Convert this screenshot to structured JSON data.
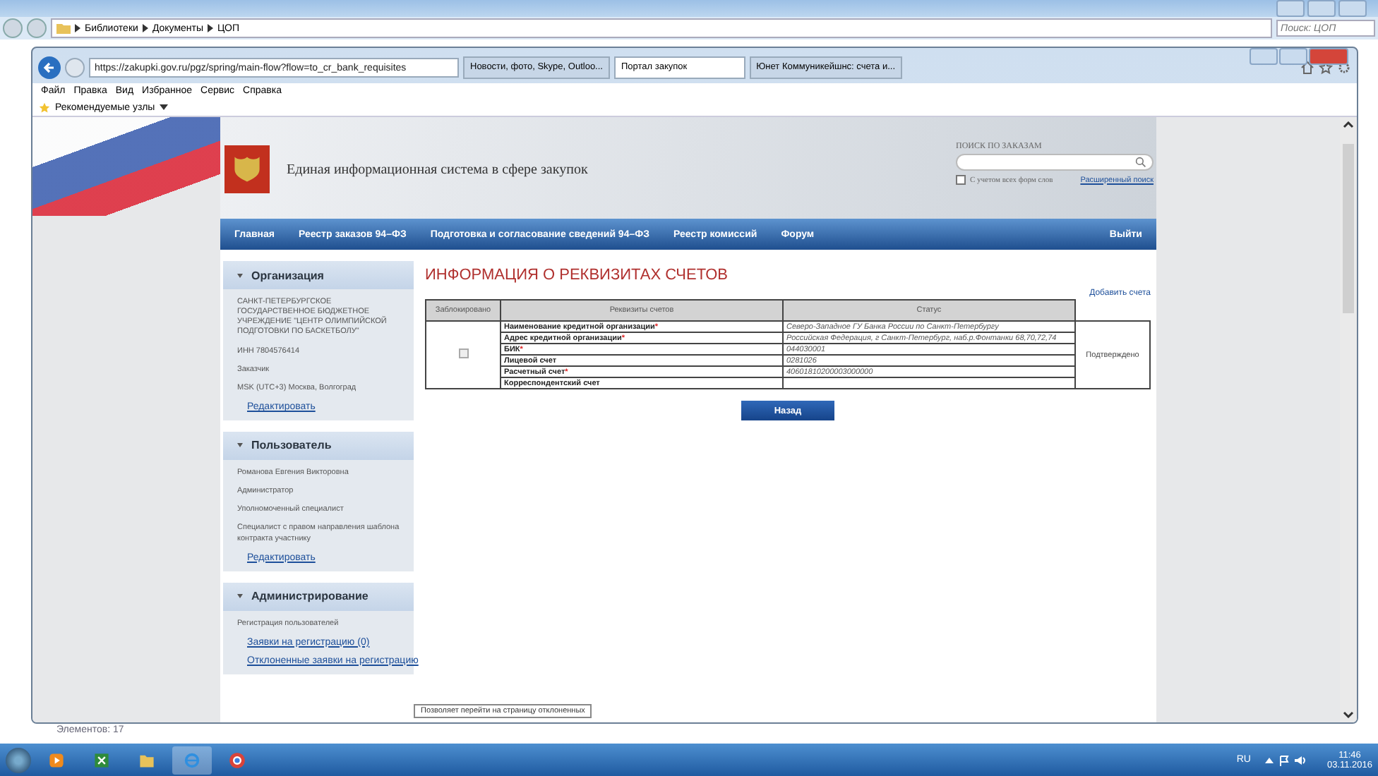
{
  "explorer": {
    "breadcrumbs": [
      "Библиотеки",
      "Документы",
      "ЦОП"
    ],
    "search_placeholder": "Поиск: ЦОП",
    "status": "Элементов: 17"
  },
  "browser": {
    "address": "https://zakupki.gov.ru/pgz/spring/main-flow?flow=to_cr_bank_requisites",
    "tabs": [
      {
        "label": "Новости, фото, Skype, Outloo...",
        "selected": false
      },
      {
        "label": "Портал закупок",
        "selected": true
      },
      {
        "label": "Юнет Коммуникейшнс: счета и...",
        "selected": false
      }
    ],
    "menu": [
      "Файл",
      "Правка",
      "Вид",
      "Избранное",
      "Сервис",
      "Справка"
    ],
    "favorites": "Рекомендуемые узлы"
  },
  "site": {
    "title": "Единая информационная система в сфере закупок",
    "search": {
      "label": "ПОИСК ПО ЗАКАЗАМ",
      "checkbox_label": "С учетом всех форм слов",
      "checked": false,
      "advanced_link": "Расширенный поиск"
    },
    "nav": [
      "Главная",
      "Реестр заказов 94–ФЗ",
      "Подготовка и согласование сведений 94–ФЗ",
      "Реестр комиссий",
      "Форум"
    ],
    "logout": "Выйти"
  },
  "sidebar": [
    {
      "title": "Организация",
      "items": [
        {
          "kind": "text",
          "text": "САНКТ-ПЕТЕРБУРГСКОЕ ГОСУДАРСТВЕННОЕ БЮДЖЕТНОЕ УЧРЕЖДЕНИЕ \"ЦЕНТР ОЛИМПИЙСКОЙ ПОДГОТОВКИ ПО БАСКЕТБОЛУ\""
        },
        {
          "kind": "text",
          "text": "ИНН 7804576414"
        },
        {
          "kind": "text",
          "text": "Заказчик"
        },
        {
          "kind": "text",
          "text": "MSK (UTC+3) Москва, Волгоград"
        },
        {
          "kind": "link",
          "text": "Редактировать"
        }
      ]
    },
    {
      "title": "Пользователь",
      "items": [
        {
          "kind": "text",
          "text": "Романова Евгения Викторовна"
        },
        {
          "kind": "text",
          "text": "Администратор"
        },
        {
          "kind": "text",
          "text": "Уполномоченный специалист"
        },
        {
          "kind": "text",
          "text": "Специалист с правом направления шаблона контракта участнику"
        },
        {
          "kind": "link",
          "text": "Редактировать"
        }
      ]
    },
    {
      "title": "Администрирование",
      "items": [
        {
          "kind": "text",
          "text": "Регистрация пользователей"
        },
        {
          "kind": "link",
          "text": "Заявки на регистрацию (0)"
        },
        {
          "kind": "link",
          "text": "Отклоненные заявки на регистрацию"
        }
      ]
    }
  ],
  "main": {
    "heading": "ИНФОРМАЦИЯ О РЕКВИЗИТАХ СЧЕТОВ",
    "add_link": "Добавить счета",
    "table": {
      "columns": [
        "Заблокировано",
        "Реквизиты счетов",
        "Статус"
      ],
      "blocked": false,
      "status": "Подтверждено",
      "fields": [
        {
          "name": "Наименование кредитной организации",
          "marker": "*",
          "value": "Северо-Западное ГУ Банка России по Санкт-Петербургу"
        },
        {
          "name": "Адрес кредитной организации",
          "marker": "*",
          "value": "Российская Федерация, г Санкт-Петербург, наб.р.Фонтанки 68,70,72,74"
        },
        {
          "name": "БИК",
          "marker": "*",
          "value": "044030001"
        },
        {
          "name": "Лицевой счет",
          "value": "0281026"
        },
        {
          "name": "Расчетный счет",
          "marker": "*",
          "value": "40601810200003000000"
        },
        {
          "name": "Корреспондентский счет"
        }
      ]
    },
    "back_button": "Назад"
  },
  "tooltip": "Позволяет перейти на страницу отклоненных",
  "taskbar": {
    "language": "RU",
    "time": "11:46",
    "date": "03.11.2016"
  }
}
